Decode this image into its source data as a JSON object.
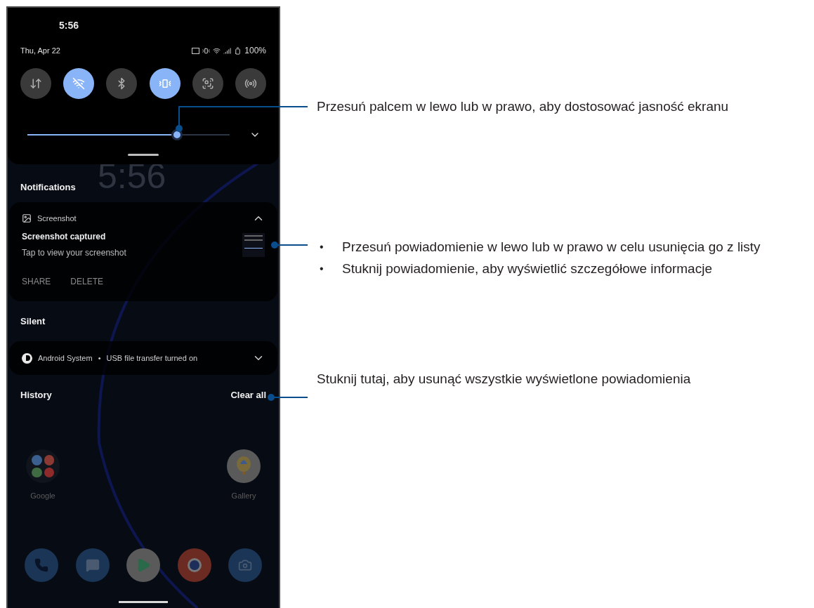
{
  "status_bar": {
    "time": "5:56",
    "date": "Thu, Apr 22",
    "battery": "100%"
  },
  "quick_tiles": [
    {
      "kind": "data",
      "on": false
    },
    {
      "kind": "wifi",
      "on": true
    },
    {
      "kind": "bluetooth",
      "on": false
    },
    {
      "kind": "vibrate",
      "on": true
    },
    {
      "kind": "scan",
      "on": false
    },
    {
      "kind": "hotspot",
      "on": false
    }
  ],
  "brightness": {
    "level": 0.74
  },
  "lock_clock": "5:56",
  "notifications": {
    "header": "Notifications",
    "items": [
      {
        "app": "Screenshot",
        "title": "Screenshot captured",
        "text": "Tap to view your screenshot",
        "actions": [
          "SHARE",
          "DELETE"
        ],
        "expanded": true
      }
    ]
  },
  "silent": {
    "header": "Silent",
    "items": [
      {
        "app": "Android System",
        "separator": "•",
        "text": "USB file transfer turned on",
        "expanded": false
      }
    ]
  },
  "history": {
    "label": "History",
    "clear": "Clear all"
  },
  "home_apps": [
    {
      "kind": "folder",
      "label": "Google"
    },
    {
      "kind": "gallery",
      "label": "Gallery"
    }
  ],
  "dock": [
    {
      "kind": "phone"
    },
    {
      "kind": "messages"
    },
    {
      "kind": "store"
    },
    {
      "kind": "browser"
    },
    {
      "kind": "camera"
    }
  ],
  "callouts": [
    {
      "kind": "text",
      "text": "Przesuń palcem w lewo lub w prawo, aby dostosować jasność ekranu"
    },
    {
      "kind": "bullets",
      "items": [
        {
          "bullet": "•",
          "text": "Przesuń powiadomienie w lewo lub w prawo w celu usunięcia go z listy"
        },
        {
          "bullet": "•",
          "text": "Stuknij powiadomienie, aby wyświetlić szczegółowe informacje"
        }
      ]
    },
    {
      "kind": "text",
      "text": "Stuknij tutaj, aby usunąć wszystkie wyświetlone powiadomienia"
    }
  ]
}
